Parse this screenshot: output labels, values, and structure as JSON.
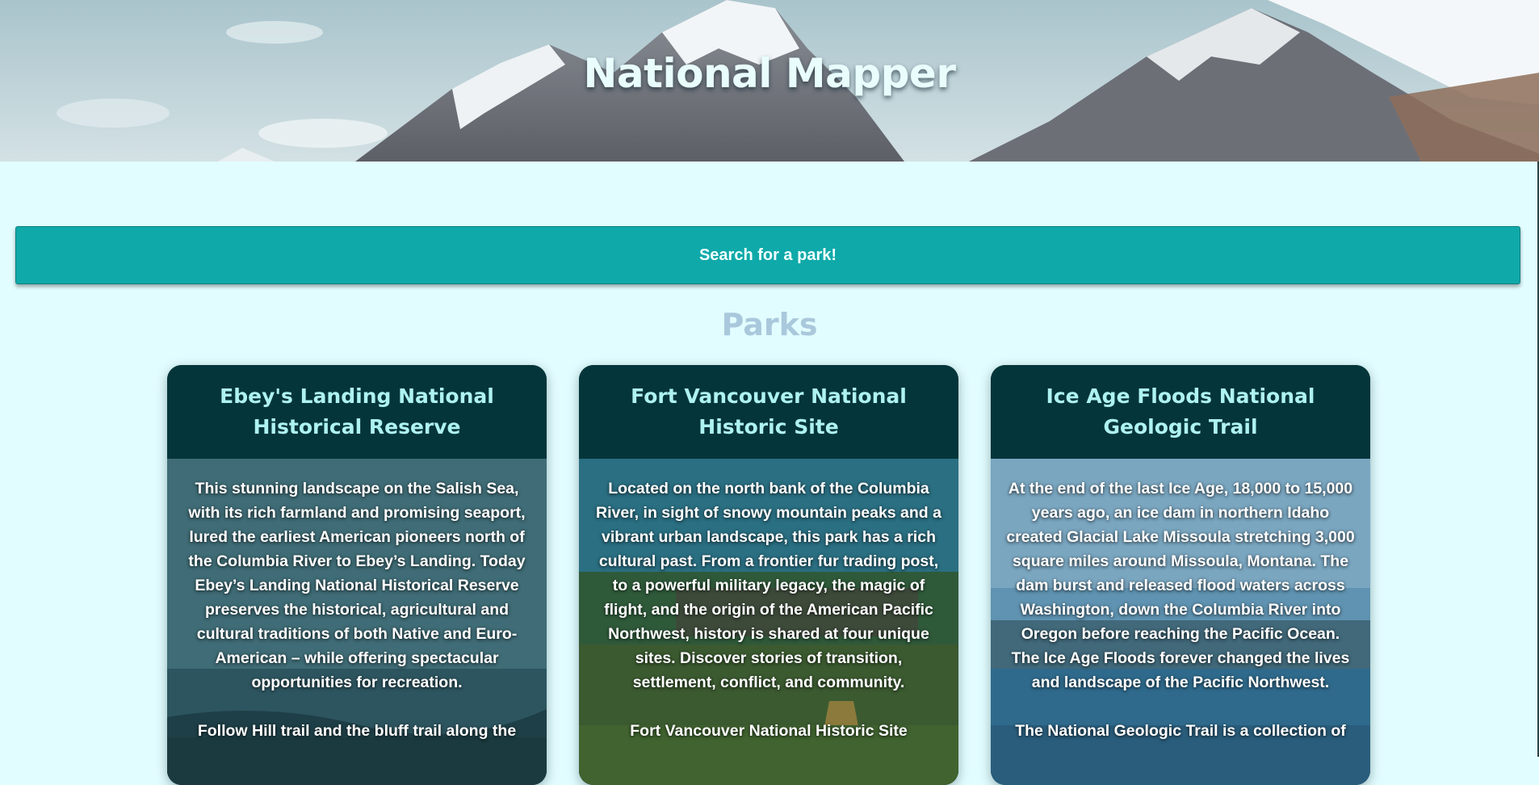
{
  "header": {
    "title": "National Mapper"
  },
  "search": {
    "label": "Search for a park!"
  },
  "parks_section": {
    "title": "Parks"
  },
  "parks": [
    {
      "name": "Ebey's Landing National Historical Reserve",
      "description": "This stunning landscape on the Salish Sea, with its rich farmland and promising seaport, lured the earliest American pioneers north of the Columbia River to Ebey’s Landing. Today Ebey’s Landing National Historical Reserve preserves the historical, agricultural and cultural traditions of both Native and Euro-American – while offering spectacular opportunities for recreation.",
      "more": "Follow Hill trail and the bluff trail along the"
    },
    {
      "name": "Fort Vancouver National Historic Site",
      "description": "Located on the north bank of the Columbia River, in sight of snowy mountain peaks and a vibrant urban landscape, this park has a rich cultural past. From a frontier fur trading post, to a powerful military legacy, the magic of flight, and the origin of the American Pacific Northwest, history is shared at four unique sites. Discover stories of transition, settlement, conflict, and community.",
      "more": "Fort Vancouver National Historic Site"
    },
    {
      "name": "Ice Age Floods National Geologic Trail",
      "description": "At the end of the last Ice Age, 18,000 to 15,000 years ago, an ice dam in northern Idaho created Glacial Lake Missoula stretching 3,000 square miles around Missoula, Montana. The dam burst and released flood waters across Washington, down the Columbia River into Oregon before reaching the Pacific Ocean. The Ice Age Floods forever changed the lives and landscape of the Pacific Northwest.",
      "more": "The National Geologic Trail is a collection of"
    }
  ]
}
